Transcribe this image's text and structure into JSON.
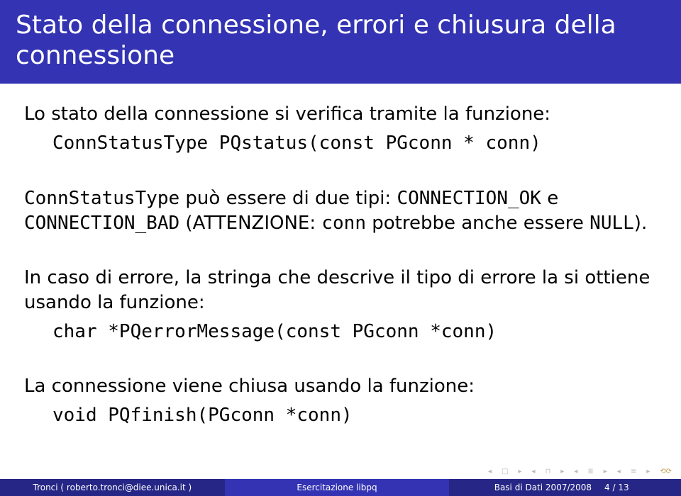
{
  "title": "Stato della connessione, errori e chiusura della connessione",
  "body": {
    "p1_intro": "Lo stato della connessione si verifica tramite la funzione:",
    "p1_code": "ConnStatusType PQstatus(const PGconn * conn)",
    "p2_a": "ConnStatusType",
    "p2_b": " può essere di due tipi: ",
    "p2_c": "CONNECTION_OK",
    "p2_d": " e ",
    "p2_e": "CONNECTION_BAD",
    "p2_f": " (ATTENZIONE: ",
    "p2_g": "conn",
    "p2_h": " potrebbe anche essere ",
    "p2_i": "NULL",
    "p2_j": ").",
    "p3_intro": "In caso di errore, la stringa che descrive il tipo di errore la si ottiene usando la funzione:",
    "p3_code": "char *PQerrorMessage(const PGconn *conn)",
    "p4_intro": "La connessione viene chiusa usando la funzione:",
    "p4_code": "void PQfinish(PGconn *conn)"
  },
  "footer": {
    "author": "Tronci ( roberto.tronci@diee.unica.it )",
    "center": "Esercitazione libpq",
    "right": "Basi di Dati 2007/2008",
    "page": "4 / 13"
  },
  "nav": {
    "cycle": "↺↷⟲"
  }
}
